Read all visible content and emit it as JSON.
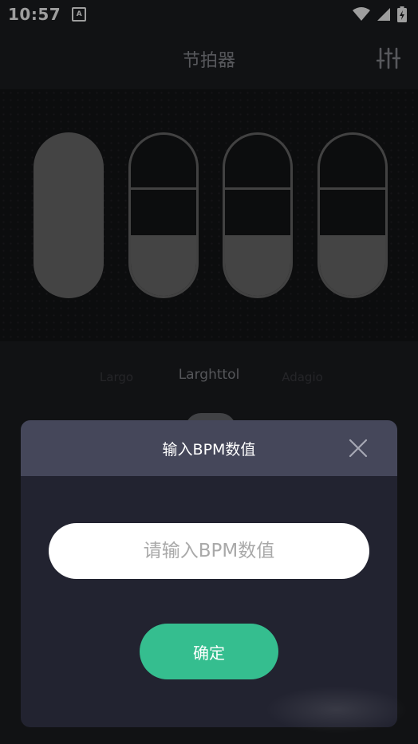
{
  "status": {
    "time": "10:57",
    "notification_icon": "A"
  },
  "header": {
    "title": "节拍器"
  },
  "beats": [
    {
      "state": "accent-filled"
    },
    {
      "state": "split"
    },
    {
      "state": "split"
    },
    {
      "state": "split"
    }
  ],
  "tempo": {
    "previous": "Largo",
    "current": "Larghttol",
    "next": "Adagio"
  },
  "dialog": {
    "title": "输入BPM数值",
    "input_value": "",
    "input_placeholder": "请输入BPM数值",
    "confirm_label": "确定"
  },
  "colors": {
    "background": "#1c1d21",
    "dialog_header": "#45475a",
    "dialog_body": "#222330",
    "confirm": "#35be8f"
  }
}
